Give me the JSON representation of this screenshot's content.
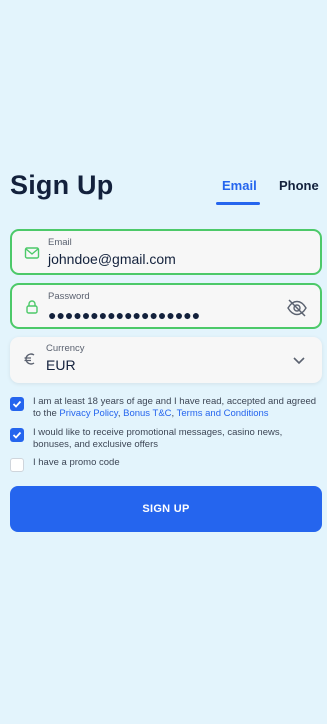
{
  "title": "Sign Up",
  "tabs": {
    "email": "Email",
    "phone": "Phone"
  },
  "email_field": {
    "label": "Email",
    "value": "johndoe@gmail.com",
    "icon": "mail-icon"
  },
  "password_field": {
    "label": "Password",
    "value": "●●●●●●●●●●●●●●●●●●",
    "icon": "lock-icon",
    "toggle_icon": "eye-off-icon"
  },
  "currency_field": {
    "label": "Currency",
    "value": "EUR",
    "icon": "euro-icon",
    "dropdown_icon": "chevron-down-icon"
  },
  "consent": {
    "prefix": "I am at least 18 years of age and I have read, accepted and agreed to the ",
    "privacy": "Privacy Policy",
    "sep1": ", ",
    "bonus": "Bonus T&C",
    "sep2": ", ",
    "terms": "Terms and Conditions"
  },
  "promo_messages": "I would like to receive promotional messages, casino news, bonuses, and exclusive offers",
  "promo_code": "I have a promo code",
  "submit": "SIGN UP",
  "colors": {
    "accent": "#2565ee",
    "success": "#4cc969",
    "background": "#e3f4fc"
  }
}
